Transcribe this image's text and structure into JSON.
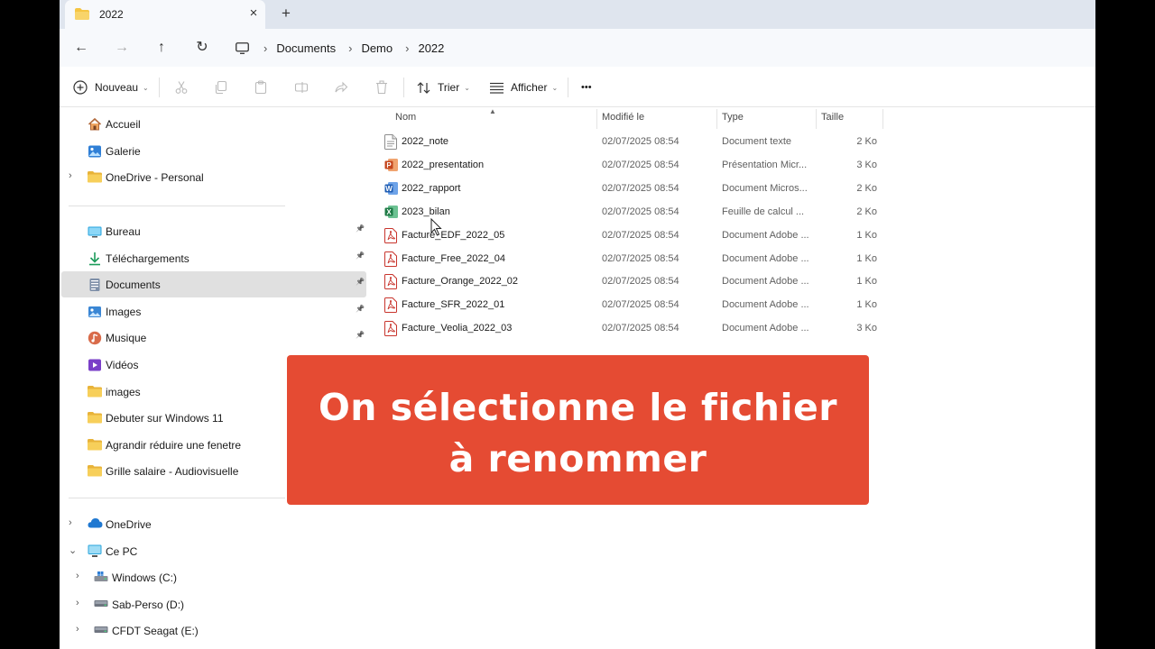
{
  "tab": {
    "title": "2022",
    "close": "×",
    "new_tab": "+"
  },
  "nav_buttons": {
    "back": "←",
    "forward": "→",
    "up": "↑",
    "refresh": "↻"
  },
  "breadcrumb": {
    "items": [
      "Documents",
      "Demo",
      "2022"
    ],
    "separator": "›"
  },
  "toolbar": {
    "new_label": "Nouveau",
    "sort_label": "Trier",
    "view_label": "Afficher",
    "more_label": "•••",
    "caret": "⌄"
  },
  "sidebar": {
    "top": [
      {
        "label": "Accueil",
        "icon": "home-icon"
      },
      {
        "label": "Galerie",
        "icon": "gallery-icon"
      },
      {
        "label": "OneDrive - Personal",
        "icon": "folder-icon",
        "expandable": true
      }
    ],
    "quick": [
      {
        "label": "Bureau",
        "icon": "desktop-icon",
        "pinned": true
      },
      {
        "label": "Téléchargements",
        "icon": "download-icon",
        "pinned": true
      },
      {
        "label": "Documents",
        "icon": "documents-icon",
        "pinned": true,
        "selected": true
      },
      {
        "label": "Images",
        "icon": "pictures-icon",
        "pinned": true
      },
      {
        "label": "Musique",
        "icon": "music-icon",
        "pinned": true
      },
      {
        "label": "Vidéos",
        "icon": "videos-icon"
      },
      {
        "label": "images",
        "icon": "folder-icon"
      },
      {
        "label": "Debuter sur Windows 11",
        "icon": "folder-icon"
      },
      {
        "label": "Agrandir réduire une fenetre",
        "icon": "folder-icon"
      },
      {
        "label": "Grille salaire - Audiovisuelle",
        "icon": "folder-icon"
      }
    ],
    "bottom": [
      {
        "label": "OneDrive",
        "icon": "cloud-icon",
        "chevron": "›"
      },
      {
        "label": "Ce PC",
        "icon": "pc-icon",
        "chevron": "⌄"
      },
      {
        "label": "Windows (C:)",
        "icon": "drive-icon",
        "chevron": "›",
        "sub": true
      },
      {
        "label": "Sab-Perso (D:)",
        "icon": "usb-drive-icon",
        "chevron": "›",
        "sub": true
      },
      {
        "label": "CFDT Seagat (E:)",
        "icon": "usb-drive-icon",
        "chevron": "›",
        "sub": true
      }
    ]
  },
  "columns": {
    "name": "Nom",
    "modified": "Modifié le",
    "type": "Type",
    "size": "Taille"
  },
  "files": [
    {
      "name": "2022_note",
      "date": "02/07/2025 08:54",
      "type": "Document texte",
      "size": "2 Ko",
      "icon": "text-file-icon"
    },
    {
      "name": "2022_presentation",
      "date": "02/07/2025 08:54",
      "type": "Présentation Micr...",
      "size": "3 Ko",
      "icon": "powerpoint-file-icon"
    },
    {
      "name": "2022_rapport",
      "date": "02/07/2025 08:54",
      "type": "Document Micros...",
      "size": "2 Ko",
      "icon": "word-file-icon"
    },
    {
      "name": "2023_bilan",
      "date": "02/07/2025 08:54",
      "type": "Feuille de calcul ...",
      "size": "2 Ko",
      "icon": "excel-file-icon"
    },
    {
      "name": "Facture_EDF_2022_05",
      "date": "02/07/2025 08:54",
      "type": "Document Adobe ...",
      "size": "1 Ko",
      "icon": "pdf-file-icon"
    },
    {
      "name": "Facture_Free_2022_04",
      "date": "02/07/2025 08:54",
      "type": "Document Adobe ...",
      "size": "1 Ko",
      "icon": "pdf-file-icon"
    },
    {
      "name": "Facture_Orange_2022_02",
      "date": "02/07/2025 08:54",
      "type": "Document Adobe ...",
      "size": "1 Ko",
      "icon": "pdf-file-icon"
    },
    {
      "name": "Facture_SFR_2022_01",
      "date": "02/07/2025 08:54",
      "type": "Document Adobe ...",
      "size": "1 Ko",
      "icon": "pdf-file-icon"
    },
    {
      "name": "Facture_Veolia_2022_03",
      "date": "02/07/2025 08:54",
      "type": "Document Adobe ...",
      "size": "3 Ko",
      "icon": "pdf-file-icon"
    }
  ],
  "banner": {
    "line1": "On sélectionne le fichier",
    "line2": "à renommer"
  },
  "colors": {
    "banner": "#e54b33",
    "tabbar": "#dfe5ee",
    "selection": "#e0e0e0",
    "folder": "#f5c542"
  }
}
